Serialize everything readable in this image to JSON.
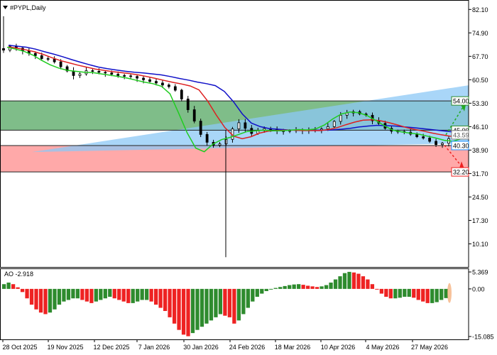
{
  "app": {
    "symbol_title": "#PYPL,Daily",
    "indicator_title": "AO -2.918",
    "colors": {
      "bull": "#2e8b2e",
      "bear": "#ee2222",
      "alligator_jaw": "#1010c8",
      "alligator_teeth": "#dd2020",
      "alligator_lips": "#20cc20",
      "green_zone": "#3a9a4a",
      "red_zone": "#ff9a9a",
      "blue_wedge": "#8cc8f6"
    }
  },
  "chart_data": [
    {
      "type": "candlestick",
      "title": "#PYPL,Daily",
      "ylim": [
        3.0,
        85.0
      ],
      "y_ticks": [
        82.1,
        74.9,
        67.7,
        60.5,
        53.3,
        46.1,
        38.9,
        31.7,
        24.5,
        17.3,
        10.1
      ],
      "x_ticks": [
        "28 Oct 2025",
        "19 Nov 2025",
        "12 Dec 2025",
        "7 Jan 2026",
        "30 Jan 2026",
        "24 Feb 2026",
        "18 Mar 2026",
        "10 Apr 2026",
        "4 May 2026",
        "27 May 2026"
      ],
      "levels": [
        {
          "label": "54.00",
          "value": 54.0,
          "color": "#2e8b2e"
        },
        {
          "label": "45.00",
          "value": 45.0,
          "color": "#2e8b2e"
        },
        {
          "label": "43.59",
          "value": 43.59,
          "color": "#808080"
        },
        {
          "label": "40.30",
          "value": 40.3,
          "color": "#1e90ff"
        },
        {
          "label": "32.20",
          "value": 32.2,
          "color": "#ee2222"
        }
      ],
      "zones": [
        {
          "name": "green",
          "from": 45.0,
          "to": 54.0
        },
        {
          "name": "red",
          "from": 32.2,
          "to": 40.3
        }
      ],
      "close_series": [
        69.6,
        70.8,
        70.2,
        69.4,
        68.6,
        67.9,
        67.0,
        66.8,
        66.0,
        64.5,
        63.2,
        61.8,
        62.3,
        63.3,
        63.1,
        62.8,
        62.6,
        62.2,
        61.8,
        61.7,
        61.5,
        61.0,
        60.5,
        60.0,
        59.5,
        58.9,
        58.4,
        57.3,
        54.6,
        51.3,
        47.8,
        43.7,
        41.3,
        40.4,
        40.8,
        42.2,
        45.4,
        47.3,
        45.6,
        44.0,
        44.9,
        45.5,
        45.2,
        44.8,
        44.8,
        44.9,
        45.1,
        45.0,
        45.1,
        45.1,
        45.4,
        46.1,
        47.7,
        49.6,
        50.3,
        50.7,
        50.0,
        49.6,
        47.9,
        47.1,
        45.6,
        44.7,
        44.6,
        44.4,
        43.8,
        43.0,
        42.6,
        41.6,
        40.6,
        41.0,
        42.4
      ],
      "alligator": {
        "jaw": [
          71.1,
          70.8,
          70.5,
          69.9,
          69.1,
          68.4,
          67.6,
          66.7,
          65.9,
          65.1,
          64.4,
          63.9,
          63.5,
          63.1,
          62.8,
          62.6,
          62.3,
          62.0,
          61.5,
          60.9,
          60.4,
          59.8,
          59.3,
          58.7,
          56.9,
          53.8,
          50.0,
          47.2,
          46.1,
          45.5,
          45.3,
          45.1,
          45.0,
          45.0,
          45.0,
          45.0,
          45.1,
          45.3,
          45.6,
          46.0,
          46.3,
          46.5,
          46.4,
          46.3,
          46.0,
          45.8,
          45.5,
          45.2,
          44.9,
          44.6,
          44.3,
          43.9
        ],
        "teeth": [
          70.6,
          70.2,
          69.7,
          69.1,
          68.3,
          67.3,
          66.4,
          65.7,
          65.0,
          64.4,
          63.8,
          63.4,
          63.0,
          62.7,
          62.4,
          62.0,
          61.5,
          60.9,
          60.3,
          59.7,
          59.2,
          58.6,
          57.4,
          54.0,
          49.7,
          45.8,
          43.2,
          42.4,
          43.0,
          44.1,
          44.7,
          44.9,
          45.0,
          45.0,
          44.9,
          44.9,
          44.9,
          45.2,
          45.8,
          46.7,
          47.5,
          48.1,
          48.2,
          47.9,
          47.3,
          46.6,
          45.8,
          45.2,
          44.7,
          44.1,
          43.6,
          43.2,
          43.0,
          43.3
        ],
        "lips": [
          70.5,
          69.9,
          69.2,
          68.1,
          66.5,
          65.1,
          64.1,
          63.4,
          63.1,
          62.8,
          62.7,
          62.3,
          61.9,
          61.5,
          61.0,
          60.4,
          59.8,
          59.3,
          58.5,
          56.2,
          50.3,
          44.2,
          39.5,
          38.4,
          40.7,
          42.1,
          42.8,
          43.7,
          44.6,
          44.8,
          45.0,
          44.8,
          44.8,
          45.0,
          45.2,
          45.1,
          45.4,
          46.6,
          48.5,
          50.0,
          50.6,
          50.4,
          49.5,
          48.0,
          46.4,
          45.0,
          44.5,
          44.1,
          43.8,
          43.2,
          42.6,
          41.9,
          41.6,
          42.4
        ]
      }
    },
    {
      "type": "bar",
      "title": "AO -2.918",
      "ylim": [
        -16.0,
        6.5
      ],
      "y_ticks": [
        5.369,
        0.0,
        -15.085
      ],
      "y_tick_labels": [
        "5.369",
        "0.00",
        "-15.085"
      ],
      "values": [
        1.5,
        2.0,
        1.5,
        0.5,
        -1.0,
        -3.0,
        -5.0,
        -6.5,
        -7.5,
        -8.0,
        -7.5,
        -6.5,
        -5.0,
        -4.0,
        -3.5,
        -3.0,
        -3.0,
        -3.5,
        -4.0,
        -4.5,
        -4.0,
        -3.5,
        -3.0,
        -2.5,
        -3.0,
        -3.5,
        -4.0,
        -4.5,
        -4.5,
        -4.0,
        -3.5,
        -3.5,
        -4.0,
        -5.0,
        -6.0,
        -7.0,
        -9.0,
        -11.0,
        -13.0,
        -14.5,
        -15.0,
        -14.0,
        -13.0,
        -12.0,
        -11.0,
        -10.0,
        -9.0,
        -8.0,
        -8.5,
        -9.0,
        -11.0,
        -10.0,
        -8.0,
        -6.0,
        -4.0,
        -2.5,
        -1.5,
        -0.7,
        -0.2,
        0.3,
        0.6,
        0.9,
        1.2,
        1.4,
        1.5,
        1.3,
        1.0,
        0.8,
        0.6,
        0.8,
        1.2,
        2.0,
        3.0,
        4.0,
        5.0,
        5.4,
        5.2,
        4.8,
        4.0,
        3.0,
        1.5,
        0.0,
        -1.5,
        -2.5,
        -3.0,
        -3.0,
        -2.8,
        -2.5,
        -2.5,
        -2.8,
        -3.5,
        -4.0,
        -4.5,
        -4.5,
        -4.2,
        -3.5,
        -2.918
      ]
    }
  ]
}
